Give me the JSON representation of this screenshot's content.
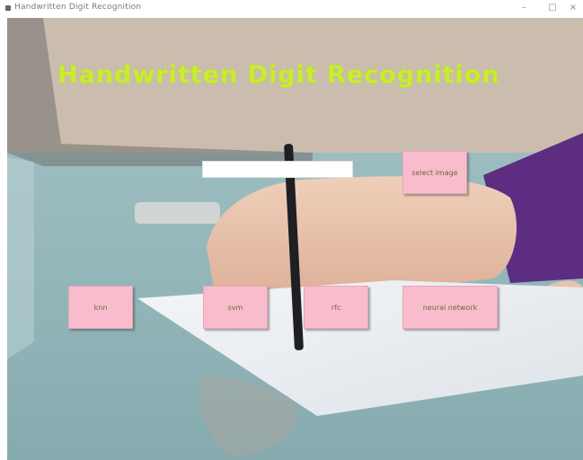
{
  "window": {
    "title": "Handwritten Digit Recognition",
    "minimize": "–",
    "maximize": "□",
    "close": "×"
  },
  "app": {
    "heading": "Handwritten Digit Recognition",
    "image_path": ""
  },
  "buttons": {
    "select_image": "select image",
    "knn": "knn",
    "svm": "svm",
    "rfc": "rfc",
    "neural_network": "neural network"
  },
  "colors": {
    "heading": "#c8ee2a",
    "button_bg": "#f8bccc"
  }
}
